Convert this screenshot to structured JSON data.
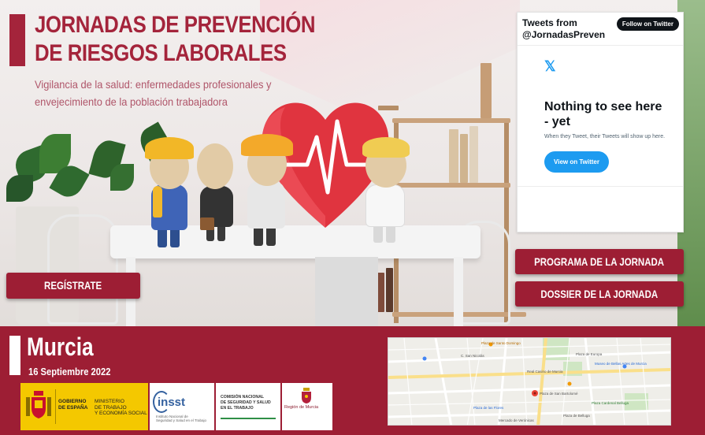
{
  "hero": {
    "title_line1": "JORNADAS DE PREVENCIÓN",
    "title_line2": "DE RIESGOS LABORALES",
    "subtitle_line1": "Vigilancia de la salud: enfermedades profesionales y",
    "subtitle_line2": "envejecimiento de la población trabajadora"
  },
  "buttons": {
    "register": "REGÍSTRATE",
    "programa": "PROGRAMA DE LA JORNADA",
    "dossier": "DOSSIER DE LA JORNADA"
  },
  "twitter": {
    "title_line1": "Tweets from",
    "title_line2": "@JornadasPreven",
    "follow": "Follow on Twitter",
    "logo": "𝕏",
    "empty_title": "Nothing to see here - yet",
    "empty_sub": "When they Tweet, their Tweets will show up here.",
    "view": "View on Twitter"
  },
  "event": {
    "city": "Murcia",
    "date": "16 Septiembre 2022"
  },
  "logos": {
    "gov_line1": "GOBIERNO",
    "gov_line2": "DE ESPAÑA",
    "min_line1": "MINISTERIO",
    "min_line2": "DE TRABAJO",
    "min_line3": "Y ECONOMÍA SOCIAL",
    "insst_word": "insst",
    "insst_sub1": "Instituto Nacional de",
    "insst_sub2": "Seguridad y Salud en el Trabajo",
    "cnsst_line1": "COMISIÓN NACIONAL",
    "cnsst_line2": "DE SEGURIDAD Y SALUD",
    "cnsst_line3": "EN EL TRABAJO",
    "murcia": "Región de Murcia"
  },
  "map": {
    "labels": [
      "Plaza de Santo Domingo",
      "Museo de Bellas Artes de Murcia",
      "Plaza de Europa",
      "Real Casino de Murcia",
      "Plaza de San Bartolomé",
      "Plaza de las Flores",
      "Plaza de Belluga",
      "Plaza Cardenal Belluga",
      "Mercado de Verónicas",
      "C. San Nicolás"
    ]
  },
  "colors": {
    "brand": "#9d1e34",
    "title": "#a4243b",
    "twitter_blue": "#1d9bf0"
  }
}
